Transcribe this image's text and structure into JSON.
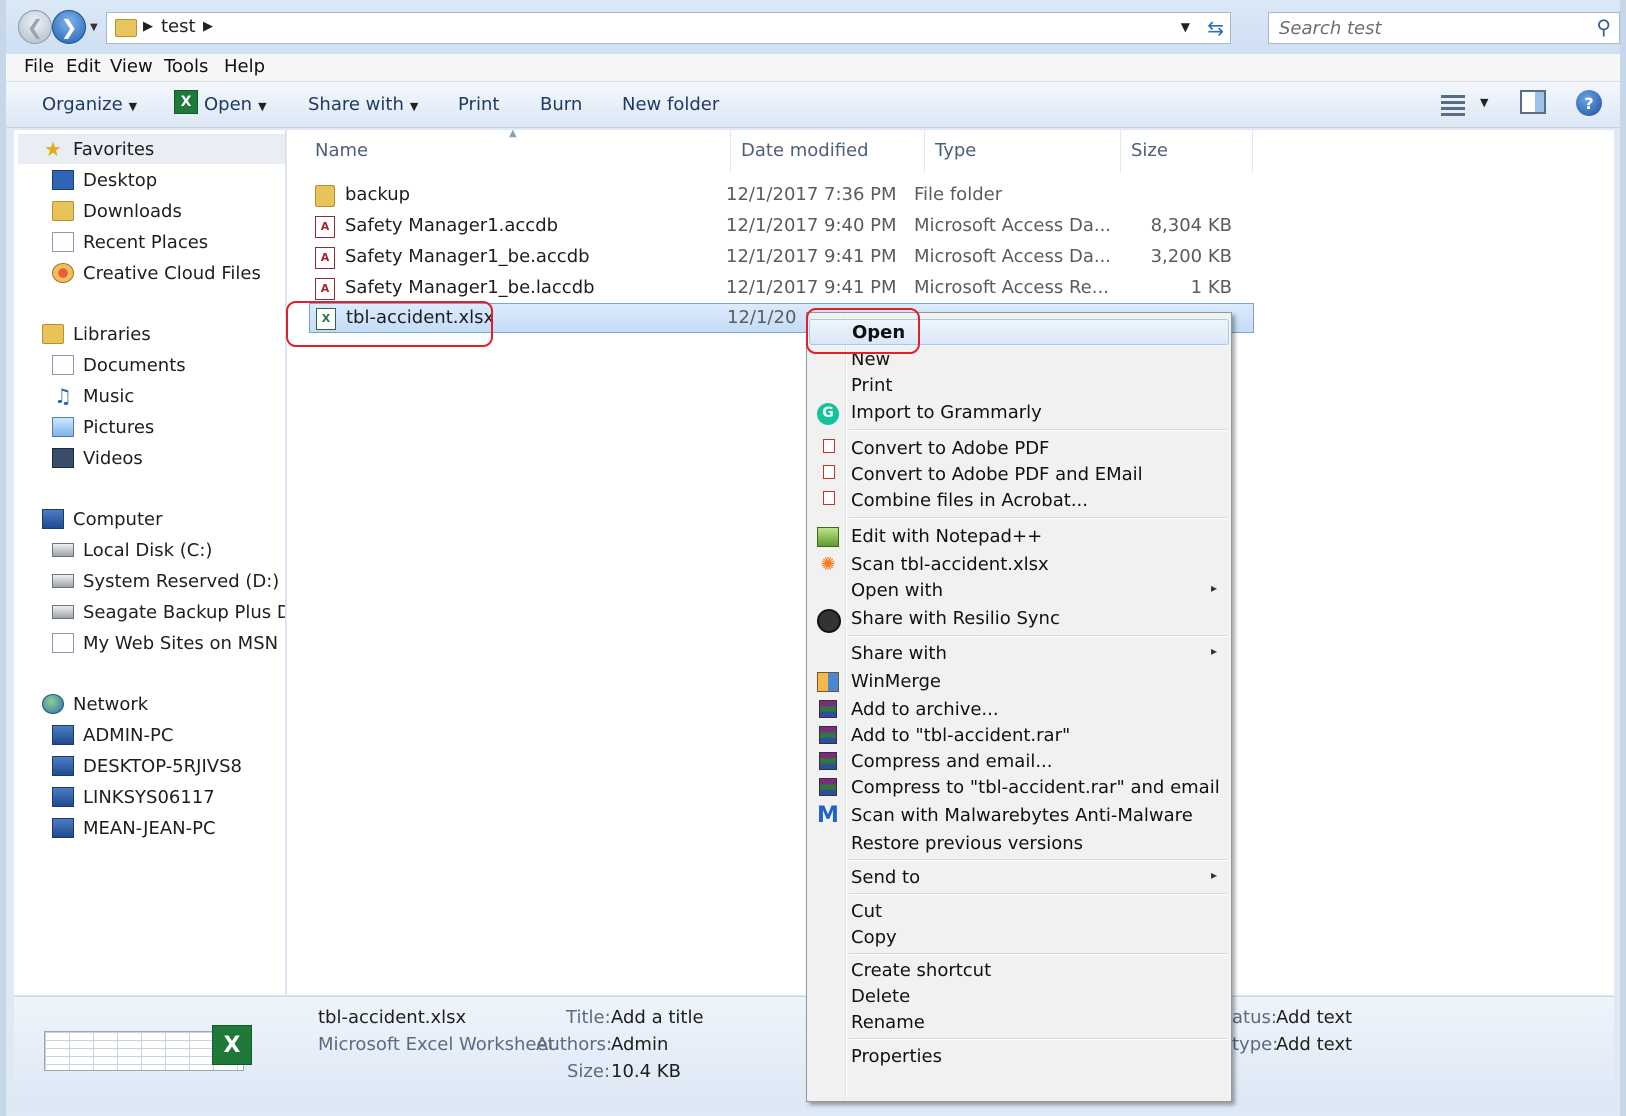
{
  "address_bar": {
    "path": "test",
    "search_placeholder": "Search test"
  },
  "menu": [
    "File",
    "Edit",
    "View",
    "Tools",
    "Help"
  ],
  "toolbar": {
    "organize": "Organize",
    "open": "Open",
    "share_with": "Share with",
    "print": "Print",
    "burn": "Burn",
    "new_folder": "New folder"
  },
  "nav": {
    "favorites": {
      "label": "Favorites",
      "items": [
        "Desktop",
        "Downloads",
        "Recent Places",
        "Creative Cloud Files"
      ]
    },
    "libraries": {
      "label": "Libraries",
      "items": [
        "Documents",
        "Music",
        "Pictures",
        "Videos"
      ]
    },
    "computer": {
      "label": "Computer",
      "items": [
        "Local Disk (C:)",
        "System Reserved (D:)",
        "Seagate Backup Plus Drive",
        "My Web Sites on MSN"
      ]
    },
    "network": {
      "label": "Network",
      "items": [
        "ADMIN-PC",
        "DESKTOP-5RJIVS8",
        "LINKSYS06117",
        "MEAN-JEAN-PC"
      ]
    }
  },
  "columns": {
    "name": "Name",
    "date": "Date modified",
    "type": "Type",
    "size": "Size"
  },
  "files": [
    {
      "name": "backup",
      "date": "12/1/2017 7:36 PM",
      "type": "File folder",
      "size": ""
    },
    {
      "name": "Safety Manager1.accdb",
      "date": "12/1/2017 9:40 PM",
      "type": "Microsoft Access Da...",
      "size": "8,304 KB"
    },
    {
      "name": "Safety Manager1_be.accdb",
      "date": "12/1/2017 9:41 PM",
      "type": "Microsoft Access Da...",
      "size": "3,200 KB"
    },
    {
      "name": "Safety Manager1_be.laccdb",
      "date": "12/1/2017 9:41 PM",
      "type": "Microsoft Access Re...",
      "size": "1 KB"
    },
    {
      "name": "tbl-accident.xlsx",
      "date": "12/1/20",
      "type": "",
      "size": ""
    }
  ],
  "context_menu": {
    "open": "Open",
    "new": "New",
    "print": "Print",
    "grammarly": "Import to Grammarly",
    "pdf": "Convert to Adobe PDF",
    "pdf_email": "Convert to Adobe PDF and EMail",
    "combine": "Combine files in Acrobat...",
    "notepad": "Edit with Notepad++",
    "scan": "Scan tbl-accident.xlsx",
    "open_with": "Open with",
    "resilio": "Share with Resilio Sync",
    "share_with": "Share with",
    "winmerge": "WinMerge",
    "add_archive": "Add to archive...",
    "add_rar": "Add to \"tbl-accident.rar\"",
    "compress_email": "Compress and email...",
    "compress_rar_email": "Compress to \"tbl-accident.rar\" and email",
    "malwarebytes": "Scan with Malwarebytes Anti-Malware",
    "restore": "Restore previous versions",
    "send_to": "Send to",
    "cut": "Cut",
    "copy": "Copy",
    "shortcut": "Create shortcut",
    "delete": "Delete",
    "rename": "Rename",
    "properties": "Properties"
  },
  "details": {
    "filename": "tbl-accident.xlsx",
    "filetype": "Microsoft Excel Worksheet",
    "title_label": "Title:",
    "title_value": "Add a title",
    "authors_label": "Authors:",
    "authors_value": "Admin",
    "size_label": "Size:",
    "size_value": "10.4 KB",
    "status_label": "atus:",
    "status_value": "Add text",
    "ctype_label": "type:",
    "ctype_value": "Add text"
  }
}
